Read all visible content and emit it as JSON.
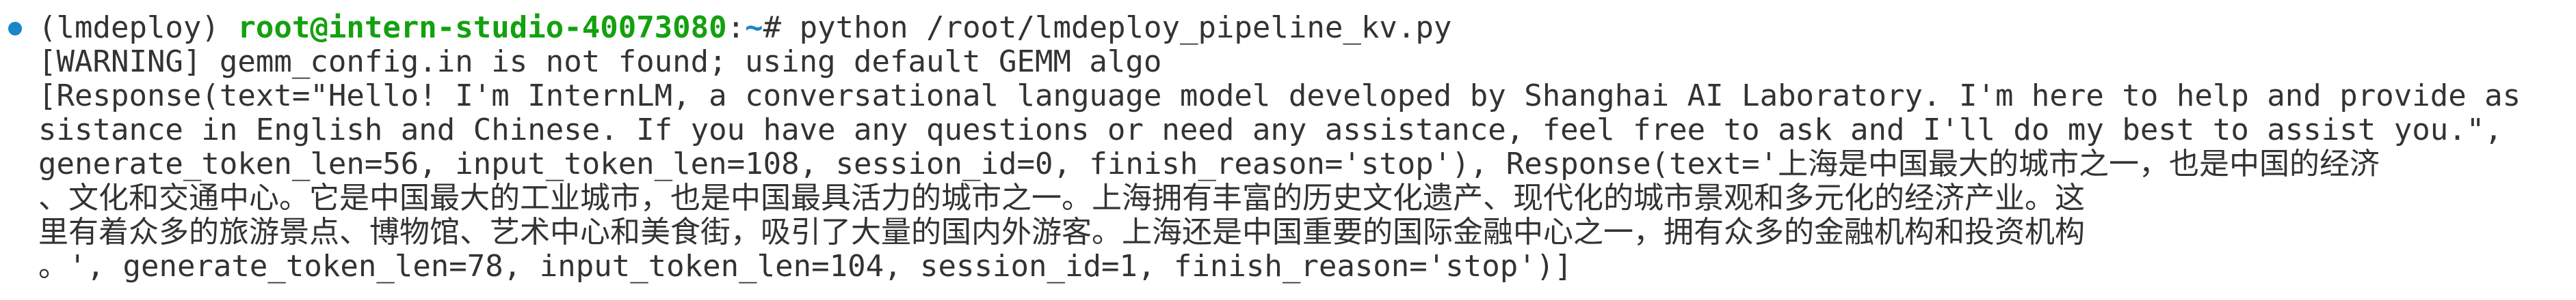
{
  "terminal": {
    "env": "(lmdeploy)",
    "user_host": "root@intern-studio-40073080",
    "path": "~",
    "prompt_sign": "#",
    "command": "python /root/lmdeploy_pipeline_kv.py",
    "status_color": "#1a85c7",
    "output_lines": [
      "[WARNING] gemm_config.in is not found; using default GEMM algo",
      "[Response(text=\"Hello! I'm InternLM, a conversational language model developed by Shanghai AI Laboratory. I'm here to help and provide as",
      "sistance in English and Chinese. If you have any questions or need any assistance, feel free to ask and I'll do my best to assist you.\",",
      "generate_token_len=56, input_token_len=108, session_id=0, finish_reason='stop'), Response(text='上海是中国最大的城市之一，也是中国的经济",
      "、文化和交通中心。它是中国最大的工业城市，也是中国最具活力的城市之一。上海拥有丰富的历史文化遗产、现代化的城市景观和多元化的经济产业。这",
      "里有着众多的旅游景点、博物馆、艺术中心和美食街，吸引了大量的国内外游客。上海还是中国重要的国际金融中心之一，拥有众多的金融机构和投资机构",
      "。', generate_token_len=78, input_token_len=104, session_id=1, finish_reason='stop')]"
    ]
  }
}
